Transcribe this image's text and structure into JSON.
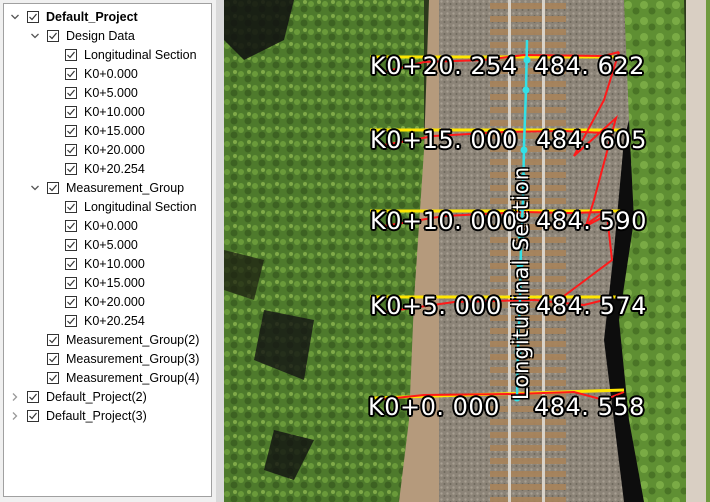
{
  "tree": {
    "items": [
      {
        "label": "Default_Project",
        "level": 0,
        "expanded": true,
        "checked": true,
        "bold": true
      },
      {
        "label": "Design Data",
        "level": 1,
        "expanded": true,
        "checked": true
      },
      {
        "label": "Longitudinal Section",
        "level": 2,
        "checked": true
      },
      {
        "label": "K0+0.000",
        "level": 2,
        "checked": true
      },
      {
        "label": "K0+5.000",
        "level": 2,
        "checked": true
      },
      {
        "label": "K0+10.000",
        "level": 2,
        "checked": true
      },
      {
        "label": "K0+15.000",
        "level": 2,
        "checked": true
      },
      {
        "label": "K0+20.000",
        "level": 2,
        "checked": true
      },
      {
        "label": "K0+20.254",
        "level": 2,
        "checked": true
      },
      {
        "label": "Measurement_Group",
        "level": 1,
        "expanded": true,
        "checked": true
      },
      {
        "label": "Longitudinal Section",
        "level": 2,
        "checked": true
      },
      {
        "label": "K0+0.000",
        "level": 2,
        "checked": true
      },
      {
        "label": "K0+5.000",
        "level": 2,
        "checked": true
      },
      {
        "label": "K0+10.000",
        "level": 2,
        "checked": true
      },
      {
        "label": "K0+15.000",
        "level": 2,
        "checked": true
      },
      {
        "label": "K0+20.000",
        "level": 2,
        "checked": true
      },
      {
        "label": "K0+20.254",
        "level": 2,
        "checked": true
      },
      {
        "label": "Measurement_Group(2)",
        "level": 1,
        "checked": true
      },
      {
        "label": "Measurement_Group(3)",
        "level": 1,
        "checked": true
      },
      {
        "label": "Measurement_Group(4)",
        "level": 1,
        "checked": true
      },
      {
        "label": "Default_Project(2)",
        "level": 0,
        "expanded": false,
        "checked": true
      },
      {
        "label": "Default_Project(3)",
        "level": 0,
        "expanded": false,
        "checked": true
      }
    ]
  },
  "map": {
    "section_label": "Longitudinal Section",
    "stations": [
      {
        "station": "K0+20. 254",
        "elevation": "484. 622"
      },
      {
        "station": "K0+15. 000",
        "elevation": "484. 605"
      },
      {
        "station": "K0+10. 000",
        "elevation": "484. 590"
      },
      {
        "station": "K0+5. 000",
        "elevation": "484. 574"
      },
      {
        "station": "K0+0. 000",
        "elevation": "484. 558"
      }
    ],
    "colors": {
      "design_line": "#ffe600",
      "measured_line": "#ff1a1a",
      "centerline": "#33e0e6"
    }
  }
}
